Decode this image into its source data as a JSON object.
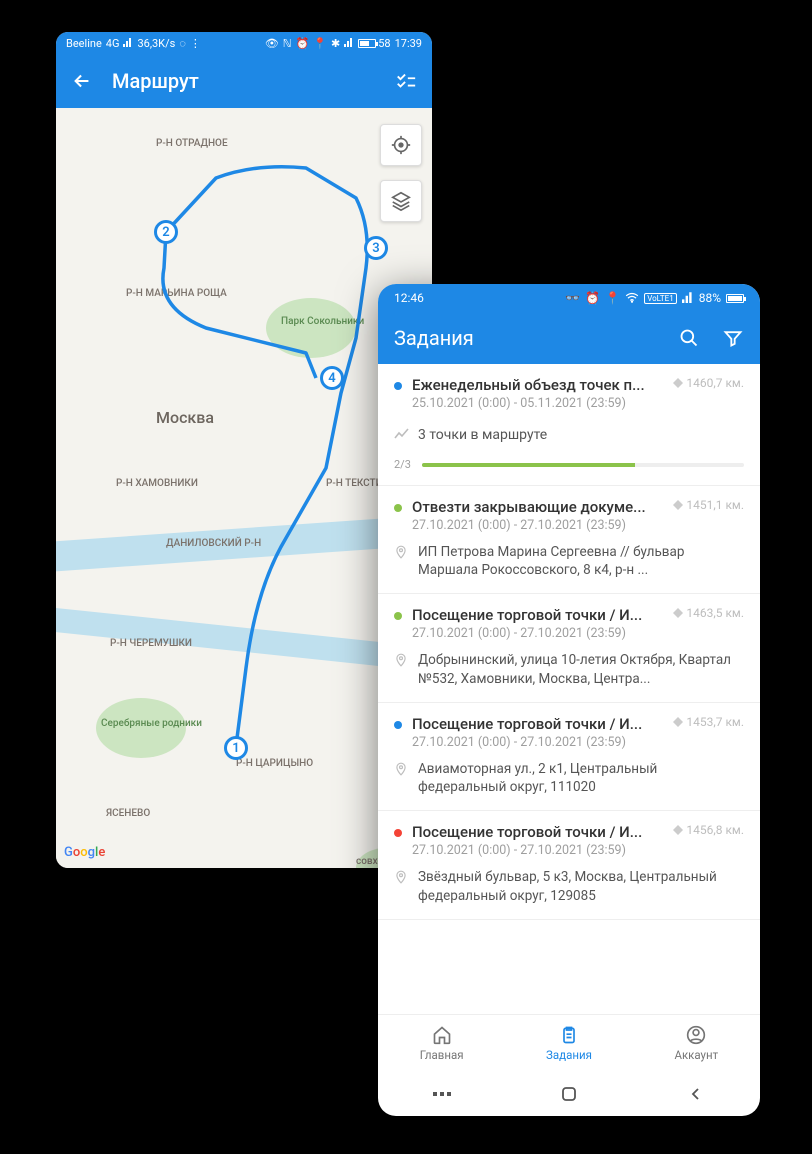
{
  "phone_a": {
    "statusbar": {
      "carrier": "Beeline",
      "network": "4G",
      "speed": "36,3K/s",
      "time": "17:39",
      "battery_pct": "58"
    },
    "appbar": {
      "title": "Маршрут"
    },
    "map": {
      "city": "Москва",
      "labels": {
        "otradnoe": "Р-Н ОТРАДНОЕ",
        "marina": "Р-Н МАРЬИНА РОЩА",
        "sokolniki": "Парк Сокольники",
        "khamovniki": "Р-Н ХАМОВНИКИ",
        "tekstil": "Р-Н ТЕКСТИЛЬ...",
        "danilov": "ДАНИЛОВСКИЙ Р-Н",
        "cheremushki": "Р-Н ЧЕРЕМУШКИ",
        "tsaritsyno": "Р-Н ЦАРИЦЫНО",
        "yasenevo": "ЯСЕНЕВО",
        "serebr": "Серебряные родники",
        "sovkhoz": "совхоз им. Лени..."
      },
      "pins": [
        "1",
        "2",
        "3",
        "4"
      ],
      "google": "Google"
    }
  },
  "phone_b": {
    "statusbar": {
      "time": "12:46",
      "battery_pct": "88%"
    },
    "appbar": {
      "title": "Задания"
    },
    "tasks": [
      {
        "status_color": "#1e88e5",
        "title": "Еженедельный объезд точек п...",
        "dates": "25.10.2021 (0:00) - 05.11.2021 (23:59)",
        "distance": "1460,7 км.",
        "points_label": "3 точки в маршруте",
        "progress_fraction": "2/3",
        "progress_pct": 66
      },
      {
        "status_color": "#8bc34a",
        "title": "Отвезти закрывающие докуме...",
        "dates": "27.10.2021 (0:00) - 27.10.2021 (23:59)",
        "distance": "1451,1 км.",
        "address": "ИП Петрова Марина Сергеевна  // бульвар Маршала Рокоссовского, 8 к4, р-н ..."
      },
      {
        "status_color": "#8bc34a",
        "title": "Посещение торговой точки / И...",
        "dates": "27.10.2021 (0:00) - 27.10.2021 (23:59)",
        "distance": "1463,5 км.",
        "address": "Добрынинский, улица 10-летия Октября, Квартал №532, Хамовники, Москва, Центра..."
      },
      {
        "status_color": "#1e88e5",
        "title": "Посещение торговой точки / И...",
        "dates": "27.10.2021 (0:00) - 27.10.2021 (23:59)",
        "distance": "1453,7 км.",
        "address": "Авиамоторная ул., 2 к1, Центральный федеральный округ, 111020"
      },
      {
        "status_color": "#f44336",
        "title": "Посещение торговой точки / И...",
        "dates": "27.10.2021 (0:00) - 27.10.2021 (23:59)",
        "distance": "1456,8 км.",
        "address": "Звёздный бульвар, 5 к3, Москва, Центральный федеральный округ, 129085"
      }
    ],
    "nav": {
      "home": "Главная",
      "tasks": "Задания",
      "account": "Аккаунт"
    }
  }
}
